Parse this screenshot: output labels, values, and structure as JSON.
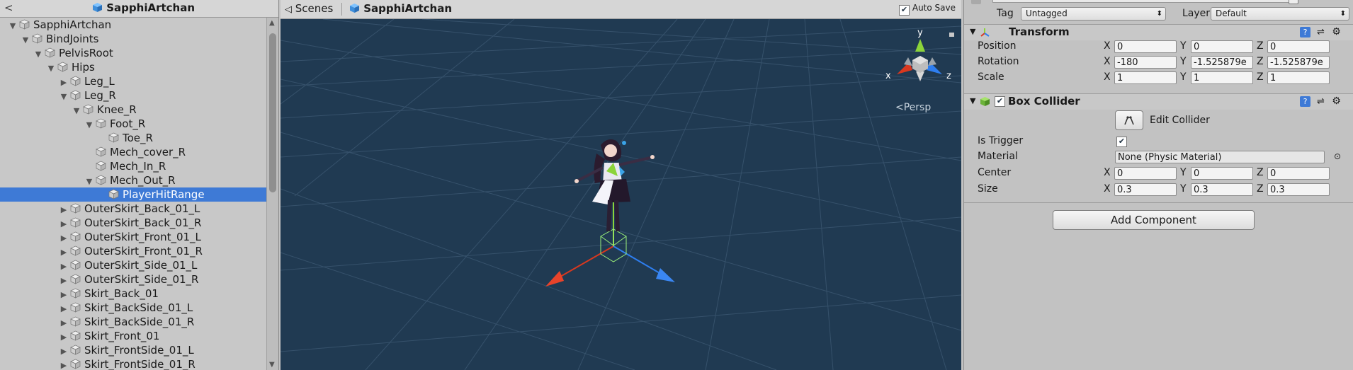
{
  "hierarchy": {
    "title": "SapphiArtchan",
    "items": [
      {
        "label": "SapphiArtchan",
        "depth": 1,
        "arrow": "▼",
        "selected": false
      },
      {
        "label": "BindJoints",
        "depth": 2,
        "arrow": "▼",
        "selected": false
      },
      {
        "label": "PelvisRoot",
        "depth": 3,
        "arrow": "▼",
        "selected": false
      },
      {
        "label": "Hips",
        "depth": 4,
        "arrow": "▼",
        "selected": false
      },
      {
        "label": "Leg_L",
        "depth": 5,
        "arrow": "▶",
        "selected": false
      },
      {
        "label": "Leg_R",
        "depth": 5,
        "arrow": "▼",
        "selected": false
      },
      {
        "label": "Knee_R",
        "depth": 6,
        "arrow": "▼",
        "selected": false
      },
      {
        "label": "Foot_R",
        "depth": 7,
        "arrow": "▼",
        "selected": false
      },
      {
        "label": "Toe_R",
        "depth": 8,
        "arrow": "",
        "selected": false
      },
      {
        "label": "Mech_cover_R",
        "depth": 7,
        "arrow": "",
        "selected": false
      },
      {
        "label": "Mech_In_R",
        "depth": 7,
        "arrow": "",
        "selected": false
      },
      {
        "label": "Mech_Out_R",
        "depth": 7,
        "arrow": "▼",
        "selected": false
      },
      {
        "label": "PlayerHitRange",
        "depth": 8,
        "arrow": "",
        "selected": true
      },
      {
        "label": "OuterSkirt_Back_01_L",
        "depth": 5,
        "arrow": "▶",
        "selected": false
      },
      {
        "label": "OuterSkirt_Back_01_R",
        "depth": 5,
        "arrow": "▶",
        "selected": false
      },
      {
        "label": "OuterSkirt_Front_01_L",
        "depth": 5,
        "arrow": "▶",
        "selected": false
      },
      {
        "label": "OuterSkirt_Front_01_R",
        "depth": 5,
        "arrow": "▶",
        "selected": false
      },
      {
        "label": "OuterSkirt_Side_01_L",
        "depth": 5,
        "arrow": "▶",
        "selected": false
      },
      {
        "label": "OuterSkirt_Side_01_R",
        "depth": 5,
        "arrow": "▶",
        "selected": false
      },
      {
        "label": "Skirt_Back_01",
        "depth": 5,
        "arrow": "▶",
        "selected": false
      },
      {
        "label": "Skirt_BackSide_01_L",
        "depth": 5,
        "arrow": "▶",
        "selected": false
      },
      {
        "label": "Skirt_BackSide_01_R",
        "depth": 5,
        "arrow": "▶",
        "selected": false
      },
      {
        "label": "Skirt_Front_01",
        "depth": 5,
        "arrow": "▶",
        "selected": false
      },
      {
        "label": "Skirt_FrontSide_01_L",
        "depth": 5,
        "arrow": "▶",
        "selected": false
      },
      {
        "label": "Skirt_FrontSide_01_R",
        "depth": 5,
        "arrow": "▶",
        "selected": false
      }
    ]
  },
  "scene": {
    "tab_label": "Scenes",
    "scene_name": "SapphiArtchan",
    "auto_save_label": "Auto Save",
    "auto_save_checked": true,
    "projection_label": "<Persp",
    "gizmo_labels": {
      "x": "x",
      "y": "y",
      "z": "z"
    },
    "background_color": "#203a52"
  },
  "inspector": {
    "tag_label": "Tag",
    "tag_value": "Untagged",
    "layer_label": "Layer",
    "layer_value": "Default",
    "transform": {
      "title": "Transform",
      "rows": [
        {
          "label": "Position",
          "x": "0",
          "y": "0",
          "z": "0"
        },
        {
          "label": "Rotation",
          "x": "-180",
          "y": "-1.525879e",
          "z": "-1.525879e"
        },
        {
          "label": "Scale",
          "x": "1",
          "y": "1",
          "z": "1"
        }
      ]
    },
    "box_collider": {
      "title": "Box Collider",
      "enabled": true,
      "edit_collider_label": "Edit Collider",
      "is_trigger_label": "Is Trigger",
      "is_trigger": true,
      "material_label": "Material",
      "material_value": "None (Physic Material)",
      "center": {
        "label": "Center",
        "x": "0",
        "y": "0",
        "z": "0"
      },
      "size": {
        "label": "Size",
        "x": "0.3",
        "y": "0.3",
        "z": "0.3"
      }
    },
    "axis_labels": {
      "x": "X",
      "y": "Y",
      "z": "Z"
    },
    "add_component_label": "Add Component"
  }
}
